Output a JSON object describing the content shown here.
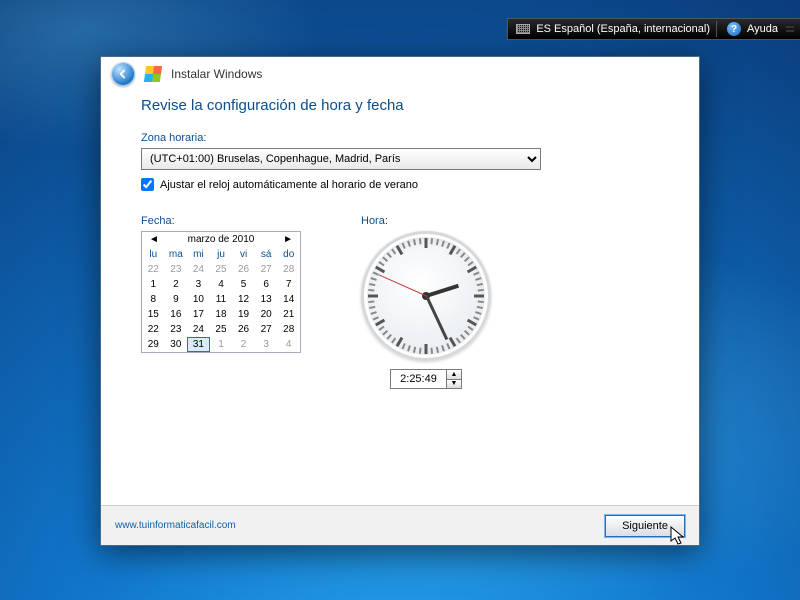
{
  "topbar": {
    "language_label": "ES Español (España, internacional)",
    "help_label": "Ayuda"
  },
  "header": {
    "window_title": "Instalar Windows"
  },
  "page": {
    "title": "Revise la configuración de hora y fecha",
    "tz_label": "Zona horaria:",
    "tz_value": "(UTC+01:00) Bruselas, Copenhague, Madrid, París",
    "dst_label": "Ajustar el reloj automáticamente al horario de verano",
    "dst_checked": true,
    "date_label": "Fecha:",
    "time_label": "Hora:"
  },
  "calendar": {
    "month_title": "marzo de 2010",
    "dow": [
      "lu",
      "ma",
      "mi",
      "ju",
      "vi",
      "sá",
      "do"
    ],
    "weeks": [
      [
        {
          "d": 22,
          "dim": true
        },
        {
          "d": 23,
          "dim": true
        },
        {
          "d": 24,
          "dim": true
        },
        {
          "d": 25,
          "dim": true
        },
        {
          "d": 26,
          "dim": true
        },
        {
          "d": 27,
          "dim": true
        },
        {
          "d": 28,
          "dim": true
        }
      ],
      [
        {
          "d": 1
        },
        {
          "d": 2
        },
        {
          "d": 3
        },
        {
          "d": 4
        },
        {
          "d": 5
        },
        {
          "d": 6
        },
        {
          "d": 7
        }
      ],
      [
        {
          "d": 8
        },
        {
          "d": 9
        },
        {
          "d": 10
        },
        {
          "d": 11
        },
        {
          "d": 12
        },
        {
          "d": 13
        },
        {
          "d": 14
        }
      ],
      [
        {
          "d": 15
        },
        {
          "d": 16
        },
        {
          "d": 17
        },
        {
          "d": 18
        },
        {
          "d": 19
        },
        {
          "d": 20
        },
        {
          "d": 21
        }
      ],
      [
        {
          "d": 22
        },
        {
          "d": 23
        },
        {
          "d": 24
        },
        {
          "d": 25
        },
        {
          "d": 26
        },
        {
          "d": 27
        },
        {
          "d": 28
        }
      ],
      [
        {
          "d": 29
        },
        {
          "d": 30
        },
        {
          "d": 31,
          "sel": true
        },
        {
          "d": 1,
          "dim": true
        },
        {
          "d": 2,
          "dim": true
        },
        {
          "d": 3,
          "dim": true
        },
        {
          "d": 4,
          "dim": true
        }
      ]
    ]
  },
  "clock": {
    "time_text": "2:25:49",
    "hour": 2,
    "minute": 25,
    "second": 49
  },
  "footer": {
    "link": "www.tuinformaticafacil.com",
    "next_label": "Siguiente"
  }
}
